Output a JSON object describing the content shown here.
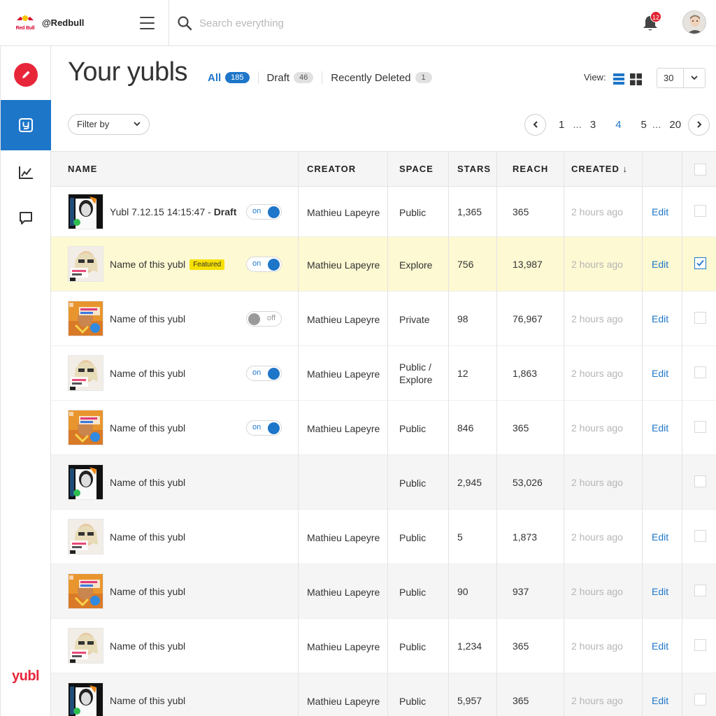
{
  "header": {
    "handle": "@Redbull",
    "brand_text": "Red Bull",
    "search_placeholder": "Search everything",
    "notifications": "12"
  },
  "sidebar": {
    "items": [
      {
        "name": "compose",
        "icon": "pencil-icon",
        "active": false
      },
      {
        "name": "yubls",
        "icon": "yubl-icon",
        "active": true
      },
      {
        "name": "analytics",
        "icon": "chart-icon",
        "active": false
      },
      {
        "name": "messages",
        "icon": "chat-icon",
        "active": false
      }
    ],
    "logo": "yubl"
  },
  "page": {
    "title": "Your yubls",
    "tabs": [
      {
        "label": "All",
        "count": "185",
        "active": true
      },
      {
        "label": "Draft",
        "count": "46",
        "active": false
      },
      {
        "label": "Recently Deleted",
        "count": "1",
        "active": false
      }
    ],
    "view_label": "View:",
    "per_page": "30",
    "filter_label": "Filter by",
    "pagination": [
      "1",
      "...",
      "3",
      "4",
      "5",
      "...",
      "20"
    ],
    "current_page": "4"
  },
  "table": {
    "columns": {
      "name": "NAME",
      "creator": "CREATOR",
      "space": "SPACE",
      "stars": "STARS",
      "reach": "REACH",
      "created": "CREATED ↓"
    },
    "rows": [
      {
        "thumb": "mono",
        "name": "Yubl 7.12.15 14:15:47 - ",
        "name_suffix": "Draft",
        "featured": "",
        "toggle": "on",
        "creator": "Mathieu Lapeyre",
        "space": "Public",
        "space2": "",
        "stars": "1,365",
        "reach": "365",
        "created": "2 hours ago",
        "edit": "Edit",
        "checked": false
      },
      {
        "thumb": "photo",
        "name": "Name of this yubl",
        "name_suffix": "",
        "featured": "Featured",
        "toggle": "on",
        "creator": "Mathieu Lapeyre",
        "space": "Explore",
        "space2": "",
        "stars": "756",
        "reach": "13,987",
        "created": "2 hours ago",
        "edit": "Edit",
        "checked": true
      },
      {
        "thumb": "orange",
        "name": "Name of this yubl",
        "name_suffix": "",
        "featured": "",
        "toggle": "off",
        "creator": "Mathieu Lapeyre",
        "space": "Private",
        "space2": "",
        "stars": "98",
        "reach": "76,967",
        "created": "2 hours ago",
        "edit": "Edit",
        "checked": false
      },
      {
        "thumb": "photo",
        "name": "Name of this yubl",
        "name_suffix": "",
        "featured": "",
        "toggle": "on",
        "creator": "Mathieu Lapeyre",
        "space": "Public /",
        "space2": "Explore",
        "stars": "12",
        "reach": "1,863",
        "created": "2 hours ago",
        "edit": "Edit",
        "checked": false
      },
      {
        "thumb": "orange",
        "name": "Name of this yubl",
        "name_suffix": "",
        "featured": "",
        "toggle": "on",
        "creator": "Mathieu Lapeyre",
        "space": "Public",
        "space2": "",
        "stars": "846",
        "reach": "365",
        "created": "2 hours ago",
        "edit": "Edit",
        "checked": false
      },
      {
        "thumb": "mono",
        "name": "Name of this yubl",
        "name_suffix": "",
        "featured": "",
        "toggle": "",
        "creator": "",
        "space": "Public",
        "space2": "",
        "stars": "2,945",
        "reach": "53,026",
        "created": "2 hours ago",
        "edit": "",
        "checked": false
      },
      {
        "thumb": "photo",
        "name": "Name of this yubl",
        "name_suffix": "",
        "featured": "",
        "toggle": "",
        "creator": "Mathieu Lapeyre",
        "space": "Public",
        "space2": "",
        "stars": "5",
        "reach": "1,873",
        "created": "2 hours ago",
        "edit": "Edit",
        "checked": false
      },
      {
        "thumb": "orange",
        "name": "Name of this yubl",
        "name_suffix": "",
        "featured": "",
        "toggle": "",
        "creator": "Mathieu Lapeyre",
        "space": "Public",
        "space2": "",
        "stars": "90",
        "reach": "937",
        "created": "2 hours ago",
        "edit": "Edit",
        "checked": false
      },
      {
        "thumb": "photo",
        "name": "Name of this yubl",
        "name_suffix": "",
        "featured": "",
        "toggle": "",
        "creator": "Mathieu Lapeyre",
        "space": "Public",
        "space2": "",
        "stars": "1,234",
        "reach": "365",
        "created": "2 hours ago",
        "edit": "Edit",
        "checked": false
      },
      {
        "thumb": "mono",
        "name": "Name of this yubl",
        "name_suffix": "",
        "featured": "",
        "toggle": "",
        "creator": "Mathieu Lapeyre",
        "space": "Public",
        "space2": "",
        "stars": "5,957",
        "reach": "365",
        "created": "2 hours ago",
        "edit": "Edit",
        "checked": false
      }
    ],
    "toggle_labels": {
      "on": "on",
      "off": "off"
    }
  },
  "colors": {
    "accent": "#1e76c9",
    "brand_red": "#e8263a",
    "featured": "#f7e000",
    "selected_row": "#fdf9d2"
  }
}
